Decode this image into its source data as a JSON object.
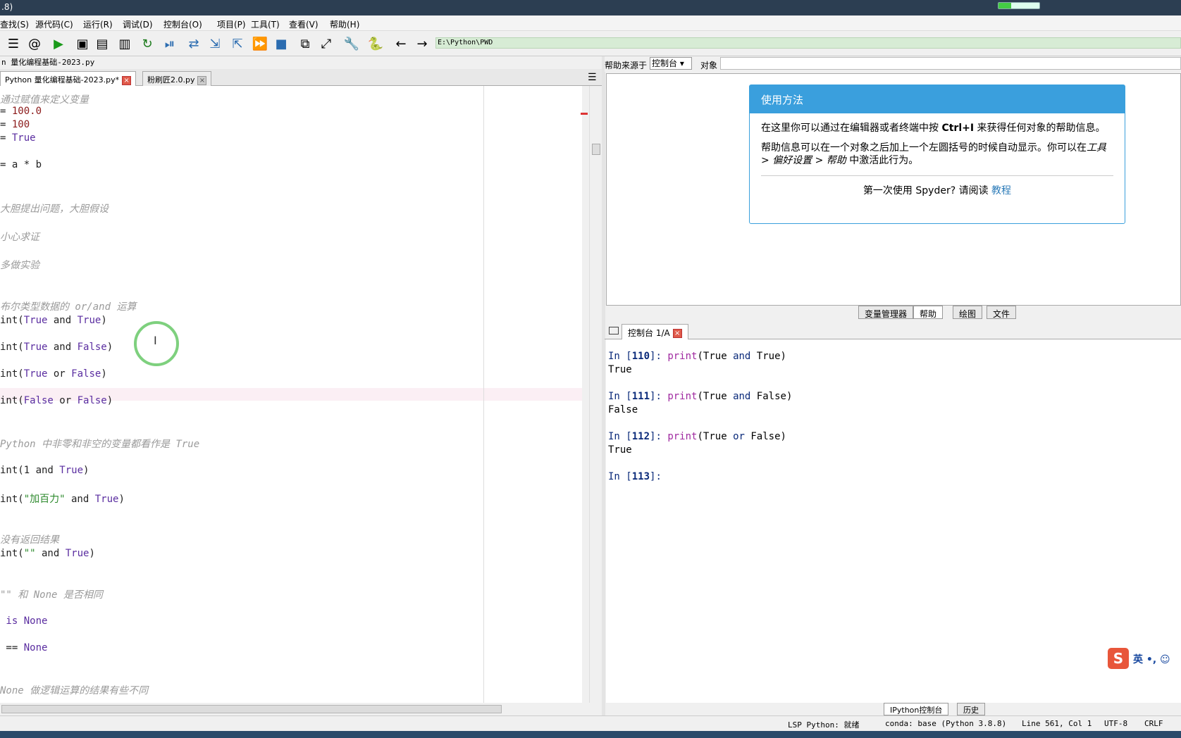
{
  "window": {
    "title": ".8)"
  },
  "menu": [
    "查找(S)",
    "源代码(C)",
    "运行(R)",
    "调试(D)",
    "控制台(O)",
    "项目(P)",
    "工具(T)",
    "查看(V)",
    "帮助(H)"
  ],
  "toolbar": {
    "icons": [
      "list-icon",
      "at-icon",
      "run-icon",
      "run-cell-icon",
      "run-cell-advance-icon",
      "run-selection-icon",
      "rerun-icon",
      "debug-icon",
      "step-icon",
      "step-into-icon",
      "step-return-icon",
      "continue-icon",
      "stop-icon",
      "maximize-pane-icon",
      "fullscreen-icon",
      "preferences-icon",
      "python-path-icon",
      "back-icon",
      "forward-icon"
    ],
    "path": "E:\\Python\\PWD"
  },
  "editor": {
    "file_path": "n 量化编程基础-2023.py",
    "tabs": [
      {
        "label": "Python 量化编程基础-2023.py*",
        "active": true
      },
      {
        "label": "粉刷匠2.0.py",
        "active": false
      }
    ],
    "lines": [
      {
        "t": "cm",
        "text": "通过赋值来定义变量"
      },
      {
        "t": "mix",
        "parts": [
          [
            "fn",
            "= "
          ],
          [
            "nm",
            "100.0"
          ]
        ]
      },
      {
        "t": "mix",
        "parts": [
          [
            "fn",
            "= "
          ],
          [
            "nm",
            "100"
          ]
        ]
      },
      {
        "t": "mix",
        "parts": [
          [
            "fn",
            "= "
          ],
          [
            "kw",
            "True"
          ]
        ]
      },
      {
        "t": "mix",
        "parts": [
          [
            "fn",
            "= a * b"
          ]
        ]
      },
      {
        "t": "cm",
        "text": "大胆提出问题，大胆假设"
      },
      {
        "t": "cm",
        "text": "小心求证"
      },
      {
        "t": "cm",
        "text": "多做实验"
      },
      {
        "t": "cm",
        "text": "布尔类型数据的 or/and 运算"
      },
      {
        "t": "mix",
        "parts": [
          [
            "fn",
            "int("
          ],
          [
            "kw",
            "True"
          ],
          [
            "fn",
            " and "
          ],
          [
            "kw",
            "True"
          ],
          [
            "fn",
            ")"
          ]
        ]
      },
      {
        "t": "mix",
        "parts": [
          [
            "fn",
            "int("
          ],
          [
            "kw",
            "True"
          ],
          [
            "fn",
            " and "
          ],
          [
            "kw",
            "False"
          ],
          [
            "fn",
            ")"
          ]
        ]
      },
      {
        "t": "mix",
        "parts": [
          [
            "fn",
            "int("
          ],
          [
            "kw",
            "True"
          ],
          [
            "fn",
            " or "
          ],
          [
            "kw",
            "False"
          ],
          [
            "fn",
            ")"
          ]
        ]
      },
      {
        "t": "mix",
        "parts": [
          [
            "fn",
            "int("
          ],
          [
            "kw",
            "False"
          ],
          [
            "fn",
            " or "
          ],
          [
            "kw",
            "False"
          ],
          [
            "fn",
            ")"
          ]
        ]
      },
      {
        "t": "cm",
        "text": "Python 中非零和非空的变量都看作是 True"
      },
      {
        "t": "mix",
        "parts": [
          [
            "fn",
            "int(1 and "
          ],
          [
            "kw",
            "True"
          ],
          [
            "fn",
            ")"
          ]
        ]
      },
      {
        "t": "mix",
        "parts": [
          [
            "fn",
            "int("
          ],
          [
            "st",
            "\"加百力\""
          ],
          [
            "fn",
            " and "
          ],
          [
            "kw",
            "True"
          ],
          [
            "fn",
            ")"
          ]
        ]
      },
      {
        "t": "cm",
        "text": "没有返回结果"
      },
      {
        "t": "mix",
        "parts": [
          [
            "fn",
            "int("
          ],
          [
            "st",
            "\"\""
          ],
          [
            "fn",
            " and "
          ],
          [
            "kw",
            "True"
          ],
          [
            "fn",
            ")"
          ]
        ]
      },
      {
        "t": "cm",
        "text": "\"\" 和 None 是否相同"
      },
      {
        "t": "mix",
        "parts": [
          [
            "kw",
            " is "
          ],
          [
            "kw",
            "None"
          ]
        ]
      },
      {
        "t": "mix",
        "parts": [
          [
            "fn",
            " == "
          ],
          [
            "kw",
            "None"
          ]
        ]
      },
      {
        "t": "cm",
        "text": "None 做逻辑运算的结果有些不同"
      }
    ]
  },
  "help": {
    "source_label": "帮助来源于",
    "source_value": "控制台",
    "object_label": "对象",
    "card_title": "使用方法",
    "para1_a": "在这里你可以通过在编辑器或者终端中按",
    "para1_key": "Ctrl+I",
    "para1_b": "来获得任何对象的帮助信息。",
    "para2_a": "帮助信息可以在一个对象之后加上一个左圆括号的时候自动显示。你可以在",
    "para2_path": "工具 > 偏好设置 > 帮助",
    "para2_b": " 中激活此行为。",
    "footer_text": "第一次使用 Spyder? 请阅读",
    "footer_link": "教程"
  },
  "pane_tabs": [
    {
      "label": "变量管理器",
      "active": false
    },
    {
      "label": "帮助",
      "active": true
    },
    {
      "label": "绘图",
      "active": false
    },
    {
      "label": "文件",
      "active": false
    }
  ],
  "console": {
    "tab_label": "控制台 1/A",
    "entries": [
      {
        "n": "110",
        "code_fn": "print",
        "code_args": [
          "True",
          "and",
          "True"
        ],
        "out": "True"
      },
      {
        "n": "111",
        "code_fn": "print",
        "code_args": [
          "True",
          "and",
          "False"
        ],
        "out": "False"
      },
      {
        "n": "112",
        "code_fn": "print",
        "code_args": [
          "True",
          "or",
          "False"
        ],
        "out": "True"
      }
    ],
    "next_prompt": "113"
  },
  "ime": {
    "logo": "S",
    "text": "英 •, ☺"
  },
  "bottom_tabs": [
    {
      "label": "IPython控制台",
      "active": true
    },
    {
      "label": "历史",
      "active": false
    }
  ],
  "status": {
    "lsp": "LSP Python: 就绪",
    "conda": "conda: base (Python 3.8.8)",
    "position": "Line 561, Col 1",
    "encoding": "UTF-8",
    "eol": "CRLF"
  }
}
